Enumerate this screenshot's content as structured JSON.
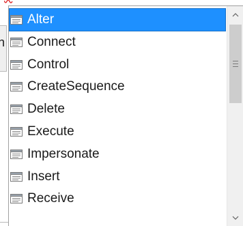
{
  "background": {
    "partial_text": "n"
  },
  "completion_list": {
    "selected_index": 0,
    "scroll_fraction": 0.0,
    "items": [
      {
        "label": "Alter",
        "icon": "keyword-icon"
      },
      {
        "label": "Connect",
        "icon": "keyword-icon"
      },
      {
        "label": "Control",
        "icon": "keyword-icon"
      },
      {
        "label": "CreateSequence",
        "icon": "keyword-icon"
      },
      {
        "label": "Delete",
        "icon": "keyword-icon"
      },
      {
        "label": "Execute",
        "icon": "keyword-icon"
      },
      {
        "label": "Impersonate",
        "icon": "keyword-icon"
      },
      {
        "label": "Insert",
        "icon": "keyword-icon"
      },
      {
        "label": "Receive",
        "icon": "keyword-icon"
      }
    ]
  },
  "colors": {
    "selection": "#1e90ff",
    "squiggle": "#e03030",
    "scrollbar_track": "#f0f0f0",
    "scrollbar_thumb": "#cdcdcd"
  }
}
